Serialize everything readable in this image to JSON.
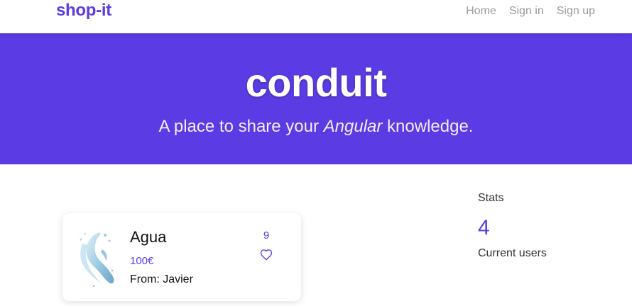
{
  "navbar": {
    "brand": "shop-it",
    "links": [
      {
        "label": "Home"
      },
      {
        "label": "Sign in"
      },
      {
        "label": "Sign up"
      }
    ]
  },
  "banner": {
    "title": "conduit",
    "tagline_before": "A place to share your ",
    "tagline_emphasis": "Angular",
    "tagline_after": " knowledge."
  },
  "products": [
    {
      "title": "Agua",
      "price": "100€",
      "seller": "From: Javier",
      "likes": "9",
      "image_icon": "water-splash-icon",
      "like_icon": "heart-outline-icon"
    }
  ],
  "stats": {
    "title": "Stats",
    "count": "4",
    "label": "Current users"
  },
  "colors": {
    "accent": "#5b3be3",
    "nav_link": "#9a9a9a",
    "text": "#111111",
    "background": "#ffffff"
  }
}
